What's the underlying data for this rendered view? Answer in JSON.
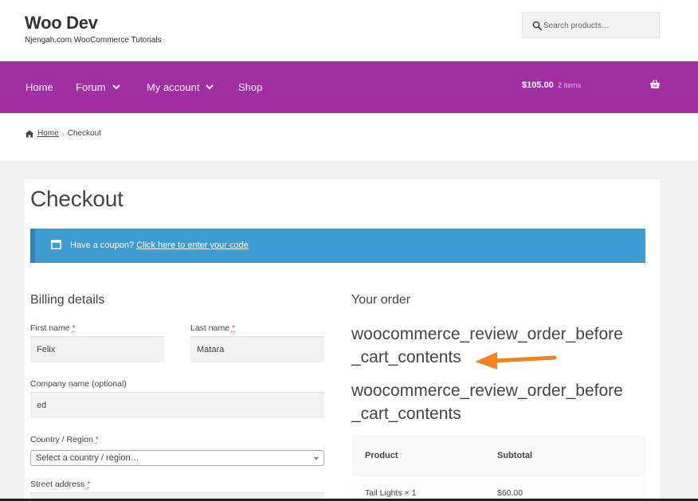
{
  "header": {
    "site_title": "Woo Dev",
    "site_description": "Njengah.com WooCommerce Tutorials",
    "search_placeholder": "Search products…"
  },
  "nav": {
    "items": [
      {
        "label": "Home",
        "has_dropdown": false
      },
      {
        "label": "Forum",
        "has_dropdown": true
      },
      {
        "label": "My account",
        "has_dropdown": true
      },
      {
        "label": "Shop",
        "has_dropdown": false
      }
    ],
    "cart_total": "$105.00",
    "cart_count": "2 items"
  },
  "breadcrumb": {
    "home": "Home",
    "separator": "›",
    "current": "Checkout"
  },
  "page": {
    "title": "Checkout",
    "coupon_text": "Have a coupon?",
    "coupon_link": "Click here to enter your code"
  },
  "billing": {
    "heading": "Billing details",
    "first_name_label": "First name",
    "first_name_value": "Felix",
    "last_name_label": "Last name",
    "last_name_value": "Matara",
    "company_label": "Company name (optional)",
    "company_value": "ed",
    "country_label": "Country / Region",
    "country_value": "Select a country / region…",
    "street_label": "Street address",
    "required_mark": "*"
  },
  "order": {
    "heading": "Your order",
    "hook_1_line1": "woocommerce_review_order_before",
    "hook_1_line2": "_cart_contents",
    "hook_2_line1": "woocommerce_review_order_before",
    "hook_2_line2": "_cart_contents",
    "col_product": "Product",
    "col_subtotal": "Subtotal",
    "rows": [
      {
        "product": "Tail Lights  × 1",
        "subtotal": "$60.00"
      }
    ]
  },
  "colors": {
    "nav_bg": "#a12fa2",
    "coupon_bg": "#3d9cd2",
    "arrow": "#f5821f",
    "required": "#e2401c"
  }
}
